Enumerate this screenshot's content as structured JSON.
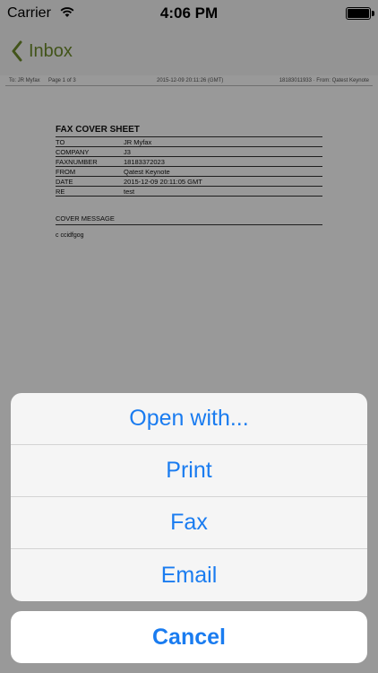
{
  "status_bar": {
    "carrier": "Carrier",
    "time": "4:06 PM"
  },
  "nav": {
    "back_label": "Inbox",
    "accent_color": "#6f8d2c"
  },
  "document": {
    "header": {
      "left": "To: JR Myfax",
      "page": "Page 1 of 3",
      "timestamp": "2015-12-09 20:11:26 (GMT)",
      "right": "18183011933 · From: Qatest Keynote"
    },
    "title": "FAX COVER SHEET",
    "rows": [
      {
        "label": "TO",
        "value": "JR Myfax"
      },
      {
        "label": "COMPANY",
        "value": "J3"
      },
      {
        "label": "FAXNUMBER",
        "value": "18183372023"
      },
      {
        "label": "FROM",
        "value": "Qatest Keynote"
      },
      {
        "label": "DATE",
        "value": "2015-12-09 20:11:05 GMT"
      },
      {
        "label": "RE",
        "value": "test"
      }
    ],
    "cover_message_label": "COVER MESSAGE",
    "cover_message": "c ccidfgog"
  },
  "action_sheet": {
    "options": [
      {
        "label": "Open with..."
      },
      {
        "label": "Print"
      },
      {
        "label": "Fax"
      },
      {
        "label": "Email"
      }
    ],
    "cancel_label": "Cancel",
    "tint_color": "#1a7cf0"
  }
}
